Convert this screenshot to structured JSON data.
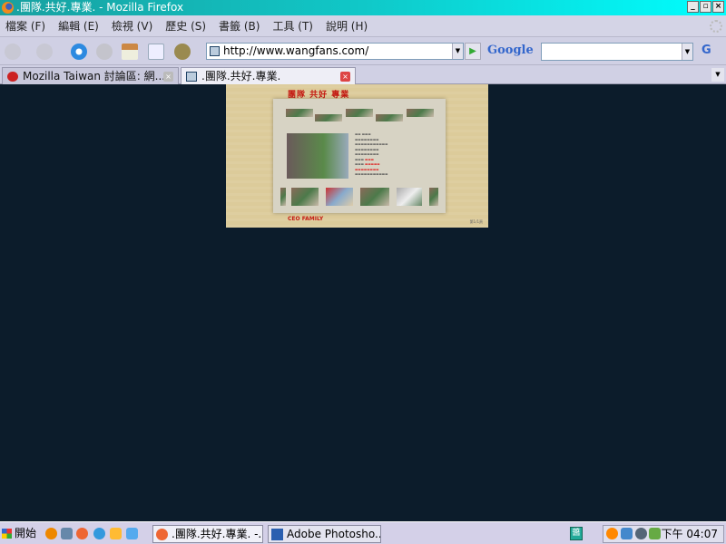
{
  "window": {
    "title": ".團隊.共好.專業. - Mozilla Firefox"
  },
  "menu": [
    "檔案 (F)",
    "編輯 (E)",
    "檢視 (V)",
    "歷史 (S)",
    "書籤 (B)",
    "工具 (T)",
    "說明 (H)"
  ],
  "navbar": {
    "url": "http://www.wangfans.com/",
    "search_brand": "Google",
    "search_value": "",
    "search_engine_icon": "G"
  },
  "tabs": [
    {
      "label": "Mozilla  Taiwan  討論區:  網..."
    },
    {
      "label": ".團隊.共好.專業."
    }
  ],
  "site": {
    "title": "團隊 共好 專業",
    "footer": "CEO FAMILY",
    "page_link": "第1/1頁"
  },
  "taskbar": {
    "start": "開始",
    "tasks": [
      ".團隊.共好.專業. -...",
      "Adobe  Photosho..."
    ],
    "ime": "醬",
    "clock": "下午 04:07"
  },
  "colors": {
    "desktop": "#0c1c2b",
    "accent_red": "#c41a12"
  }
}
